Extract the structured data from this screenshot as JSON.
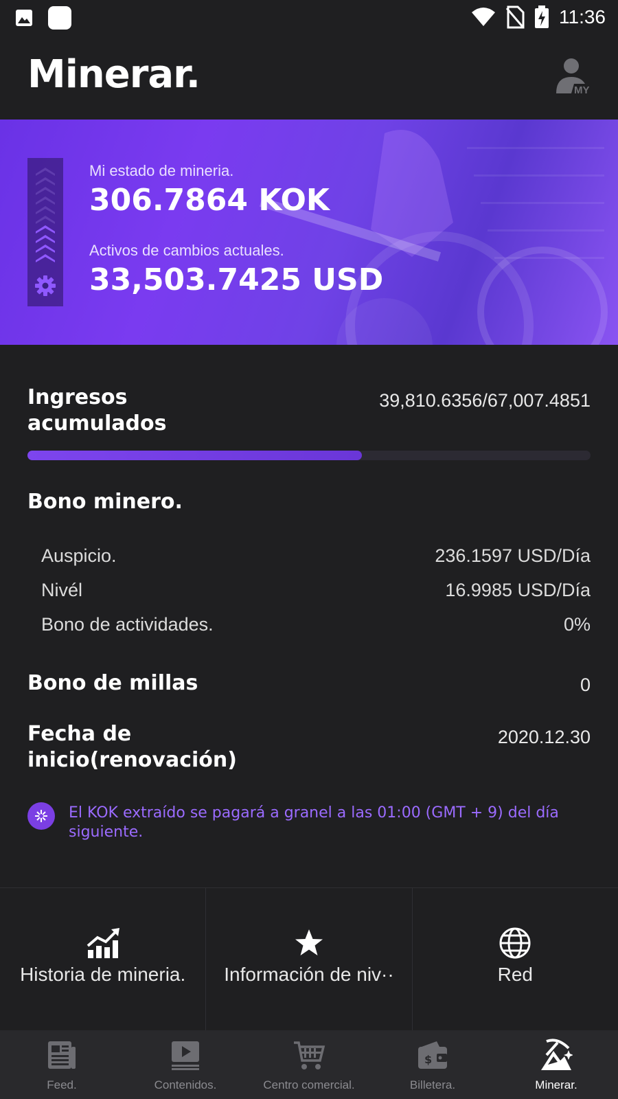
{
  "status_bar": {
    "time": "11:36",
    "icons": [
      "image-icon",
      "app-square-icon",
      "wifi-icon",
      "no-sim-icon",
      "battery-charging-icon"
    ]
  },
  "header": {
    "title": "Minerar.",
    "profile_icon": "my-profile-icon",
    "profile_badge": "MY"
  },
  "banner": {
    "status_label": "Mi estado de mineria.",
    "status_value": "306.7864 KOK",
    "assets_label": "Activos de cambios actuales.",
    "assets_value": "33,503.7425 USD",
    "level_icon": "settings-gear-icon",
    "level_filled": 4,
    "level_total": 10
  },
  "income": {
    "title_line1": "Ingresos",
    "title_line2": "acumulados",
    "value": "39,810.6356/67,007.4851",
    "progress_fraction": 0.594
  },
  "bonus": {
    "title": "Bono minero.",
    "rows": [
      {
        "label": "Auspicio.",
        "value": "236.1597 USD/Día"
      },
      {
        "label": "Nivél",
        "value": "16.9985 USD/Día"
      },
      {
        "label": "Bono de actividades.",
        "value": "0%"
      }
    ]
  },
  "miles": {
    "title": "Bono de millas",
    "value": "0"
  },
  "start_date": {
    "title_line1": "Fecha de",
    "title_line2": "inicio(renovación)",
    "value": "2020.12.30"
  },
  "notice": {
    "icon": "asterisk-info-icon",
    "text": "El KOK extraído se pagará a granel a las 01:00 (GMT + 9) del día siguiente."
  },
  "quick_actions": [
    {
      "label": "Historia de mineria.",
      "icon": "chart-trend-icon"
    },
    {
      "label": "Información de niv··",
      "icon": "star-icon"
    },
    {
      "label": "Red",
      "icon": "globe-icon"
    }
  ],
  "bottom_nav": [
    {
      "label": "Feed.",
      "icon": "feed-icon",
      "active": false
    },
    {
      "label": "Contenidos.",
      "icon": "video-icon",
      "active": false
    },
    {
      "label": "Centro comercial.",
      "icon": "cart-icon",
      "active": false
    },
    {
      "label": "Billetera.",
      "icon": "wallet-icon",
      "active": false
    },
    {
      "label": "Minerar.",
      "icon": "mining-icon",
      "active": true
    }
  ],
  "colors": {
    "accent": "#7b3fe4",
    "notice_text": "#9b6bff",
    "background": "#1f1f21",
    "nav_background": "#29292c"
  }
}
